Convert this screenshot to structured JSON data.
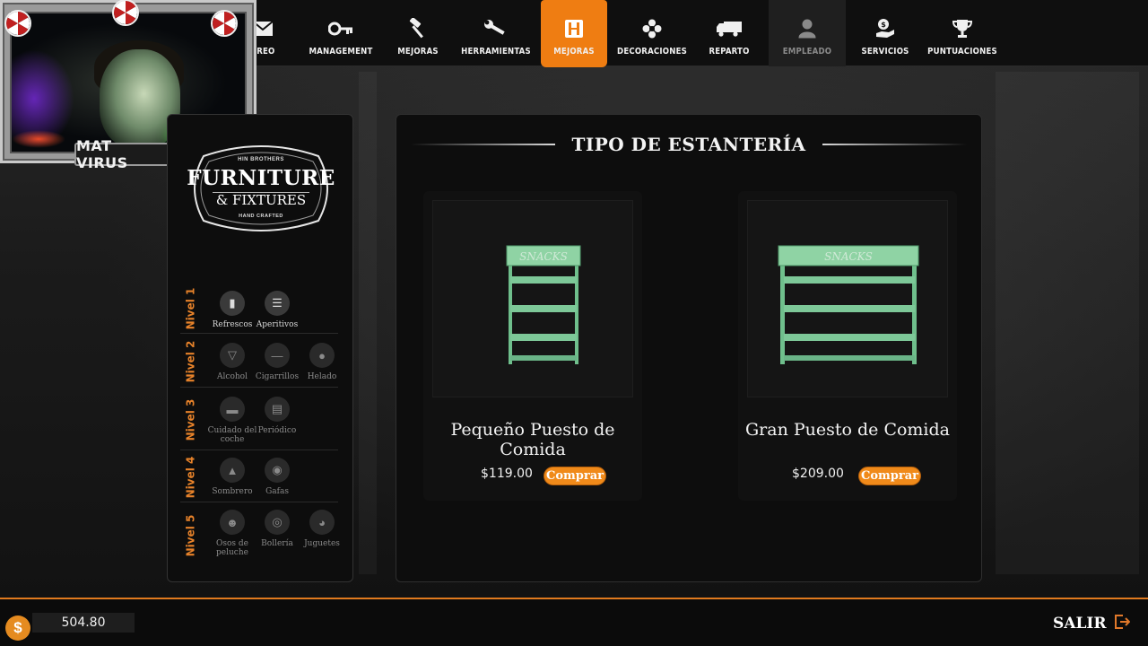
{
  "nav": {
    "items": [
      {
        "label": "CORREO",
        "icon": "envelope-icon"
      },
      {
        "label": "MANAGEMENT",
        "icon": "key-icon"
      },
      {
        "label": "MEJORAS",
        "icon": "hammer-icon"
      },
      {
        "label": "HERRAMIENTAS",
        "icon": "wrench-icon"
      },
      {
        "label": "MEJORAS",
        "icon": "shelf-icon"
      },
      {
        "label": "DECORACIONES",
        "icon": "flower-icon"
      },
      {
        "label": "REPARTO",
        "icon": "truck-icon"
      },
      {
        "label": "EMPLEADO",
        "icon": "person-icon"
      },
      {
        "label": "SERVICIOS",
        "icon": "hand-coin-icon"
      },
      {
        "label": "PUNTUACIONES",
        "icon": "trophy-icon"
      }
    ],
    "visible_first_label": "RREO",
    "active_index": 4,
    "disabled_index": 7,
    "accent_color": "#ef7d12"
  },
  "webcam": {
    "name": "MAT VIRUS"
  },
  "brand": {
    "top": "HIN BROTHERS",
    "main": "FURNITURE",
    "sub": "& FIXTURES",
    "bottom": "HAND CRAFTED"
  },
  "levels": [
    {
      "label": "Nivel 1",
      "items": [
        {
          "name": "Refrescos",
          "icon": "bottle-icon"
        },
        {
          "name": "Aperitivos",
          "icon": "burger-icon"
        }
      ]
    },
    {
      "label": "Nivel 2",
      "items": [
        {
          "name": "Alcohol",
          "icon": "wine-icon"
        },
        {
          "name": "Cigarrillos",
          "icon": "cigarette-icon"
        },
        {
          "name": "Helado",
          "icon": "icecream-icon"
        }
      ]
    },
    {
      "label": "Nivel 3",
      "items": [
        {
          "name": "Cuidado del coche",
          "icon": "car-icon"
        },
        {
          "name": "Periódico",
          "icon": "newspaper-icon"
        }
      ]
    },
    {
      "label": "Nivel 4",
      "items": [
        {
          "name": "Sombrero",
          "icon": "hat-icon"
        },
        {
          "name": "Gafas",
          "icon": "glasses-icon"
        }
      ]
    },
    {
      "label": "Nivel 5",
      "items": [
        {
          "name": "Osos de peluche",
          "icon": "teddy-icon"
        },
        {
          "name": "Bollería",
          "icon": "donut-icon"
        },
        {
          "name": "Juguetes",
          "icon": "ball-icon"
        }
      ]
    }
  ],
  "main": {
    "title": "TIPO DE ESTANTERÍA",
    "cards": [
      {
        "name": "Pequeño Puesto de Comida",
        "price": "$119.00",
        "buy_label": "Comprar",
        "shelf_sign": "SNACKS"
      },
      {
        "name": "Gran Puesto de Comida",
        "price": "$209.00",
        "buy_label": "Comprar",
        "shelf_sign": "SNACKS"
      }
    ]
  },
  "footer": {
    "money_symbol": "$",
    "money": "504.80",
    "exit_label": "SALIR"
  }
}
